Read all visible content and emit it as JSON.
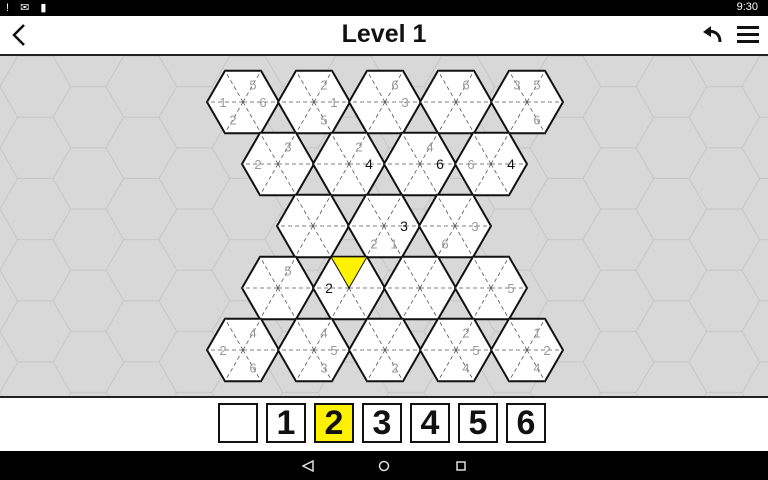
{
  "status_bar": {
    "left_icons": "! ✉ ▮",
    "time": "9:30"
  },
  "header": {
    "title": "Level 1"
  },
  "icons": {
    "back": "back-arrow-icon",
    "undo": "undo-icon",
    "menu": "hamburger-menu-icon"
  },
  "colors": {
    "highlight": "#fff200",
    "board_bg": "#d8d8d8",
    "hint": "#9a9a9a",
    "solved": "#111111"
  },
  "puzzle": {
    "cells": [
      {
        "row": 0,
        "col": 0,
        "clues": [
          "5",
          "6",
          "",
          "2",
          "1",
          ""
        ],
        "values": []
      },
      {
        "row": 0,
        "col": 1,
        "clues": [
          "2",
          "1",
          "5",
          "",
          "",
          ""
        ],
        "values": []
      },
      {
        "row": 0,
        "col": 2,
        "clues": [
          "6",
          "3",
          "",
          "",
          "",
          ""
        ],
        "values": []
      },
      {
        "row": 0,
        "col": 3,
        "clues": [
          "6",
          "",
          "",
          "",
          "",
          ""
        ],
        "values": []
      },
      {
        "row": 0,
        "col": 4,
        "clues": [
          "5",
          "",
          "6",
          "",
          "",
          "3"
        ],
        "values": []
      },
      {
        "row": 1,
        "col": 0,
        "clues": [
          "3",
          "",
          "",
          "",
          "2",
          ""
        ],
        "values": []
      },
      {
        "row": 1,
        "col": 1,
        "clues": [
          "2",
          "",
          "",
          "",
          "",
          ""
        ],
        "values": [
          {
            "pos": 1,
            "v": "4"
          }
        ]
      },
      {
        "row": 1,
        "col": 2,
        "clues": [
          "4",
          "",
          "",
          "",
          "",
          ""
        ],
        "values": [
          {
            "pos": 1,
            "v": "6"
          }
        ]
      },
      {
        "row": 1,
        "col": 3,
        "clues": [
          "",
          "",
          "",
          "",
          "6",
          ""
        ],
        "values": [
          {
            "pos": 1,
            "v": "4"
          }
        ]
      },
      {
        "row": 2,
        "col": 0,
        "clues": [
          "",
          "",
          "",
          "",
          "",
          ""
        ],
        "values": []
      },
      {
        "row": 2,
        "col": 1,
        "clues": [
          "",
          "",
          "1",
          "2",
          "",
          ""
        ],
        "values": [
          {
            "pos": 1,
            "v": "3"
          }
        ]
      },
      {
        "row": 2,
        "col": 2,
        "clues": [
          "",
          "3",
          "",
          "6",
          "",
          ""
        ],
        "values": []
      },
      {
        "row": 3,
        "col": 0,
        "clues": [
          "5",
          "",
          "",
          "",
          "",
          ""
        ],
        "values": []
      },
      {
        "row": 3,
        "col": 1,
        "clues": [
          "",
          "",
          "",
          "",
          "",
          ""
        ],
        "values": [
          {
            "pos": 4,
            "v": "2",
            "highlight": true
          }
        ]
      },
      {
        "row": 3,
        "col": 2,
        "clues": [
          "",
          "",
          "",
          "",
          "",
          ""
        ],
        "values": []
      },
      {
        "row": 3,
        "col": 3,
        "clues": [
          "",
          "5",
          "",
          "",
          "",
          ""
        ],
        "values": []
      },
      {
        "row": 4,
        "col": 0,
        "clues": [
          "4",
          "",
          "6",
          "",
          "2",
          ""
        ],
        "values": []
      },
      {
        "row": 4,
        "col": 1,
        "clues": [
          "4",
          "5",
          "3",
          "",
          "",
          ""
        ],
        "values": []
      },
      {
        "row": 4,
        "col": 2,
        "clues": [
          "",
          "",
          "2",
          "",
          "",
          ""
        ],
        "values": []
      },
      {
        "row": 4,
        "col": 3,
        "clues": [
          "2",
          "5",
          "4",
          "",
          "",
          ""
        ],
        "values": []
      },
      {
        "row": 4,
        "col": 4,
        "clues": [
          "1",
          "2",
          "4",
          "",
          "",
          ""
        ],
        "values": []
      }
    ]
  },
  "palette": [
    {
      "label": "",
      "selected": false
    },
    {
      "label": "1",
      "selected": false
    },
    {
      "label": "2",
      "selected": true
    },
    {
      "label": "3",
      "selected": false
    },
    {
      "label": "4",
      "selected": false
    },
    {
      "label": "5",
      "selected": false
    },
    {
      "label": "6",
      "selected": false
    }
  ],
  "navbar": {
    "back": "nav-back-icon",
    "home": "nav-home-icon",
    "recents": "nav-recents-icon"
  }
}
